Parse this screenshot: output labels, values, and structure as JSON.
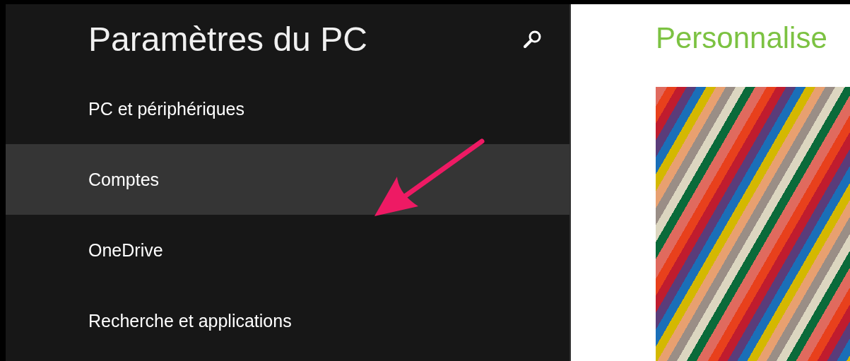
{
  "sidebar": {
    "title": "Paramètres du PC",
    "items": [
      {
        "label": "PC et périphériques",
        "selected": false
      },
      {
        "label": "Comptes",
        "selected": true
      },
      {
        "label": "OneDrive",
        "selected": false
      },
      {
        "label": "Recherche et applications",
        "selected": false
      }
    ]
  },
  "content": {
    "title": "Personnalise"
  }
}
